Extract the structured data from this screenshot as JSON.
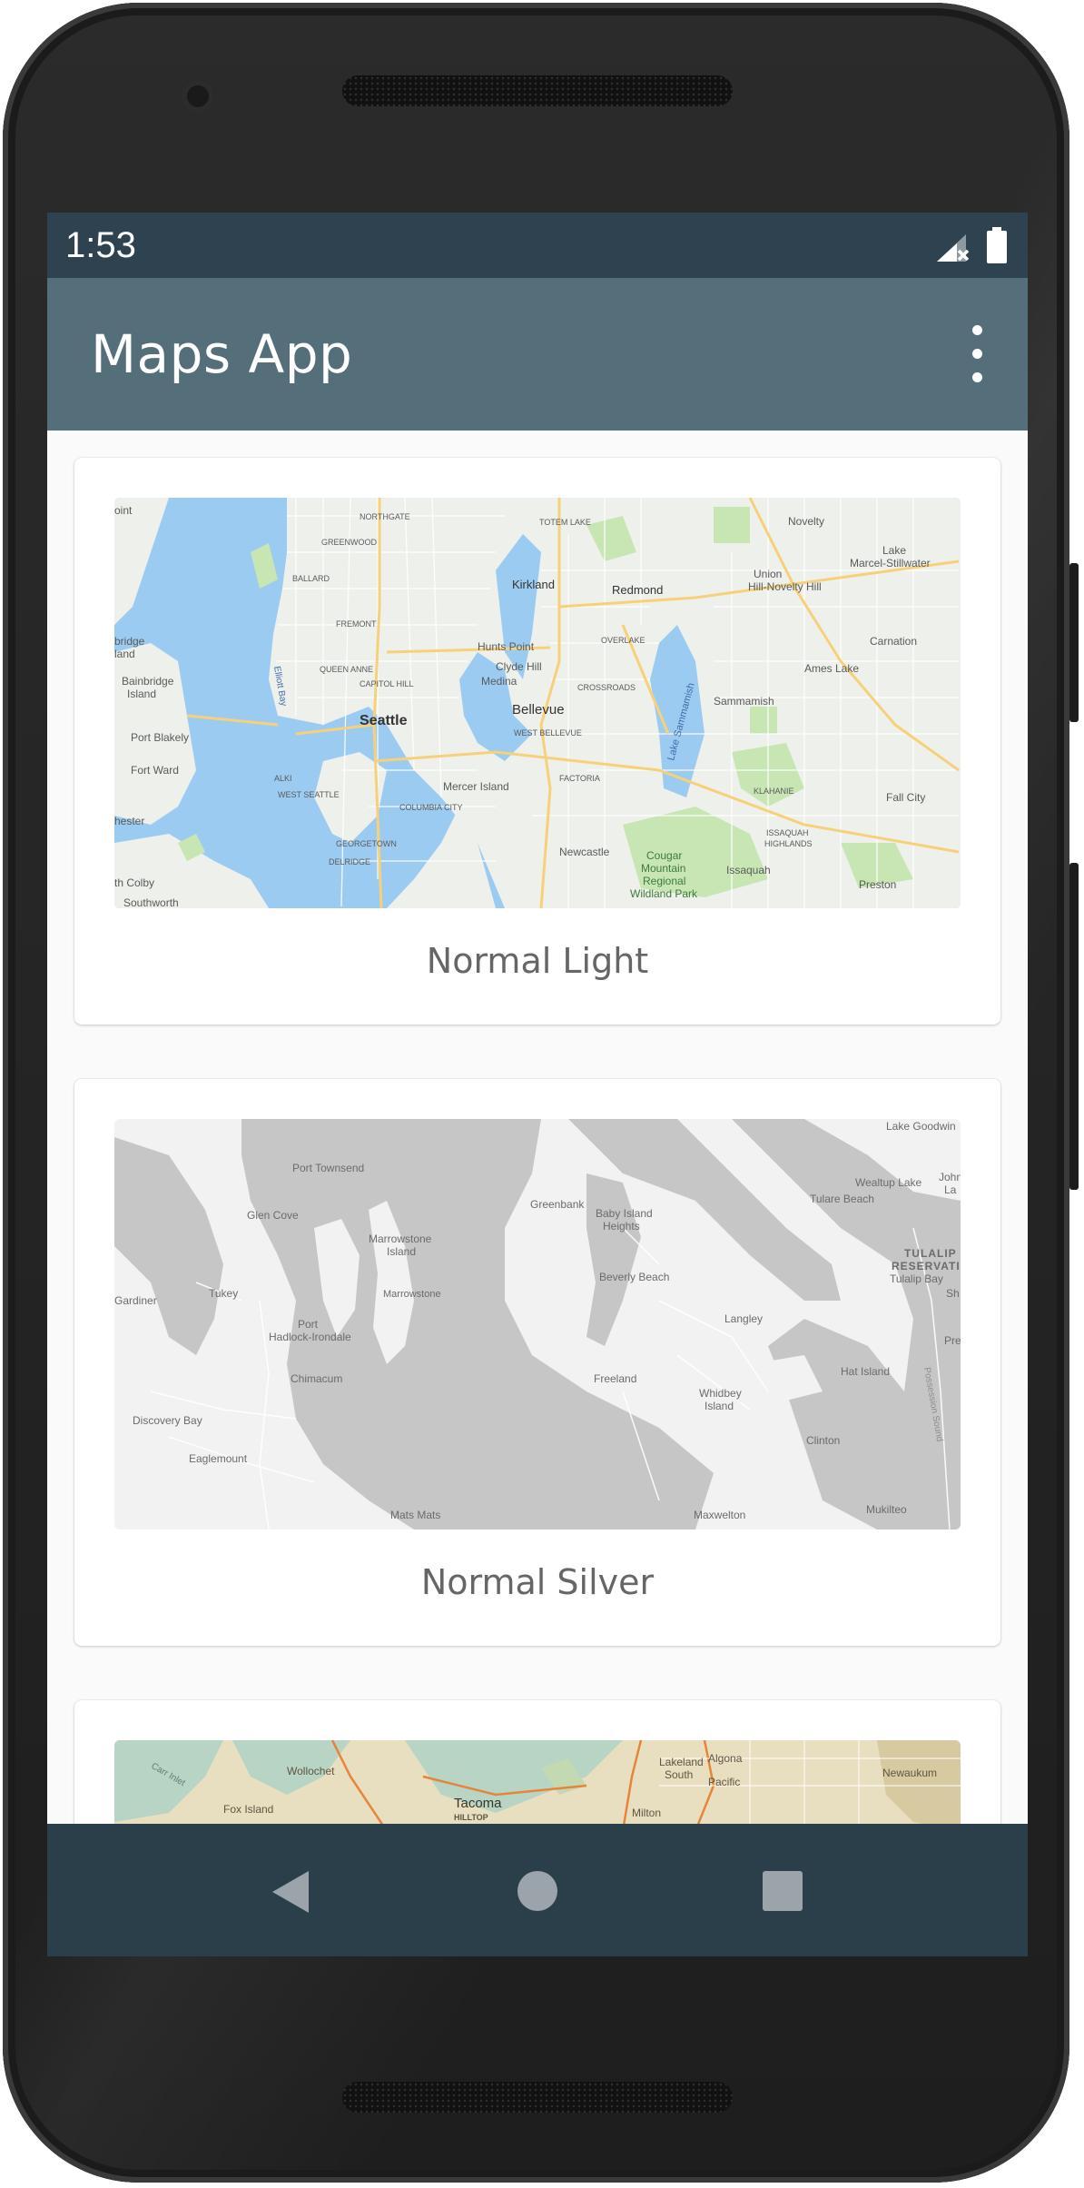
{
  "status_bar": {
    "time": "1:53",
    "signal_icon": "signal-no-data-icon",
    "battery_icon": "battery-full-icon"
  },
  "app_bar": {
    "title": "Maps App",
    "menu_icon": "more-vert-icon"
  },
  "cards": [
    {
      "label": "Normal Light",
      "map_labels": {
        "seattle": "Seattle",
        "bellevue": "Bellevue",
        "kirkland": "Kirkland",
        "redmond": "Redmond",
        "sammamish": "Sammamish",
        "issaquah": "Issaquah",
        "mercer_island": "Mercer Island",
        "newcastle": "Newcastle",
        "cougar": "Cougar",
        "mountain": "Mountain",
        "regional": "Regional",
        "wildland_park": "Wildland Park",
        "bainbridge": "Bainbridge",
        "island": "Island",
        "port_blakely": "Port Blakely",
        "fort_ward": "Fort Ward",
        "hester": "hester",
        "th_colby": "th Colby",
        "novelty": "Novelty",
        "union": "Union",
        "hill_novelty": "Hill-Novelty Hill",
        "lake": "Lake",
        "marcel": "Marcel-Stillwater",
        "carnation": "Carnation",
        "ames_lake": "Ames Lake",
        "fall_city": "Fall City",
        "preston": "Preston",
        "hunts_point": "Hunts Point",
        "clyde_hill": "Clyde Hill",
        "medina": "Medina",
        "crossroads": "CROSSROADS",
        "factoria": "FACTORIA",
        "klahanie": "KLAHANIE",
        "issaquah_highlands": "ISSAQUAH",
        "highlands": "HIGHLANDS",
        "queen_anne": "QUEEN ANNE",
        "capitol_hill": "CAPITOL HILL",
        "ballard": "BALLARD",
        "greenwood": "GREENWOOD",
        "northgate": "NORTHGATE",
        "fremont": "FREMONT",
        "west_seattle": "WEST SEATTLE",
        "alki": "ALKI",
        "georgetown": "GEORGETOWN",
        "delridge": "DELRIDGE",
        "columbia_city": "COLUMBIA CITY",
        "totem_lake": "TOTEM LAKE",
        "overlake": "OVERLAKE",
        "west_bellevue": "WEST BELLEVUE",
        "lake_sammamish": "Lake Sammamish",
        "elliott_bay": "Elliott Bay",
        "bridge": "bridge",
        "land": "land",
        "oint": "oint",
        "southworth": "Southworth"
      }
    },
    {
      "label": "Normal Silver",
      "map_labels": {
        "port_townsend": "Port Townsend",
        "glen_cove": "Glen Cove",
        "marrowstone_island": "Marrowstone",
        "island": "Island",
        "marrowstone": "Marrowstone",
        "gardiner": "Gardiner",
        "tukey": "Tukey",
        "port": "Port",
        "hadlock": "Hadlock-Irondale",
        "chimacum": "Chimacum",
        "discovery_bay": "Discovery Bay",
        "eaglemount": "Eaglemount",
        "mats_mats": "Mats Mats",
        "greenbank": "Greenbank",
        "baby_island": "Baby Island",
        "heights": "Heights",
        "beverly_beach": "Beverly Beach",
        "langley": "Langley",
        "freeland": "Freeland",
        "whidbey": "Whidbey",
        "whidbey_island": "Island",
        "maxwelton": "Maxwelton",
        "clinton": "Clinton",
        "mukilteo": "Mukilteo",
        "hat_island": "Hat Island",
        "lake_goodwin": "Lake Goodwin",
        "wealtup_lake": "Wealtup Lake",
        "tulare_beach": "Tulare Beach",
        "tulalip": "TULALIP",
        "reservation": "RESERVATIO",
        "tulalip_bay": "Tulalip Bay",
        "john": "John",
        "la": "La",
        "sh": "Sh",
        "pre": "Pre",
        "possession_sound": "Possession Sound"
      }
    },
    {
      "label": "",
      "map_labels": {
        "wollochet": "Wollochet",
        "fox_island": "Fox Island",
        "tacoma": "Tacoma",
        "hilltop": "HILLTOP",
        "milton": "Milton",
        "lakeland": "Lakeland",
        "south": "South",
        "algona": "Algona",
        "pacific": "Pacific",
        "newaukum": "Newaukum",
        "carr_inlet": "Carr Inlet"
      }
    }
  ],
  "nav_bar": {
    "back_icon": "back-triangle-icon",
    "home_icon": "home-circle-icon",
    "recents_icon": "recents-square-icon"
  },
  "colors": {
    "status_bar": "#2e434f",
    "app_bar": "#546e7a",
    "nav_bar": "#2b3f4b",
    "water_light": "#9ccbf2",
    "land_light": "#eef0ec",
    "park": "#c8e6b3",
    "road": "#f7d17a",
    "land_silver": "#f2f2f2",
    "water_silver": "#c6c6c6",
    "land_retro": "#e8dfc1",
    "water_retro": "#b7d4c5"
  }
}
